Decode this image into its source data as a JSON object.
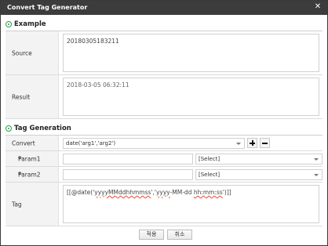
{
  "window": {
    "title": "Convert Tag Generator",
    "close_glyph": "✕"
  },
  "example": {
    "heading": "Example",
    "source_label": "Source",
    "source_value": "20180305183211",
    "result_label": "Result",
    "result_value": "2018-03-05 06:32:11"
  },
  "generation": {
    "heading": "Tag Generation",
    "convert_label": "Convert",
    "convert_value": "date('arg1','arg2')",
    "param1_label": "Param1",
    "param1_value": "",
    "param1_select": "[Select]",
    "param2_label": "Param2",
    "param2_value": "",
    "param2_select": "[Select]",
    "tag_label": "Tag",
    "tag_prefix": "[[@date('",
    "tag_arg1": "yyyyMMddhhmmss",
    "tag_mid": "','",
    "tag_arg2a": "yyyy",
    "tag_arg2b": "-MM-dd ",
    "tag_arg2c": "hh:mm:ss",
    "tag_suffix": "')]]",
    "required_mark": "*"
  },
  "footer": {
    "apply_label": "적용",
    "cancel_label": "취소"
  }
}
